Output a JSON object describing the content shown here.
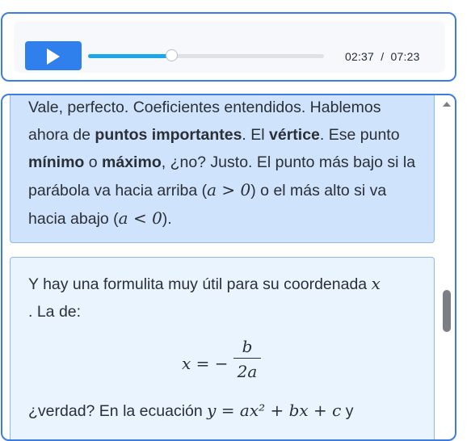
{
  "player": {
    "current_time": "02:37",
    "separator": "/",
    "total_time": "07:23",
    "progress": 0.355,
    "play_icon": "play-icon"
  },
  "messages": [
    {
      "parts": [
        "Vale, perfecto. Coeficientes entendidos. Hablemos ahora de ",
        "puntos importantes",
        ". El ",
        "vértice",
        ". Ese punto ",
        "mínimo",
        " o ",
        "máximo",
        ", ¿no? Justo. El punto más bajo si la parábola va hacia arriba (",
        "a > 0",
        ") o el más alto si va hacia abajo (",
        "a < 0",
        ")."
      ]
    },
    {
      "intro": "Y hay una formulita muy útil para su coordenada ",
      "intro_var": "x",
      "intro_end": " . La de:",
      "formula_lhs": "x = −",
      "formula_num": "b",
      "formula_den": "2a",
      "outro": "¿verdad? En la ecuación ",
      "outro_math": "y = ax² + bx + c",
      "outro_end": " y"
    }
  ],
  "colors": {
    "accent": "#3e7de0",
    "play_button": "#2f80ed",
    "progress_fill": "#1ea7e8",
    "message_highlight": "#cfe3fc",
    "message_normal": "#e9f4ff"
  }
}
